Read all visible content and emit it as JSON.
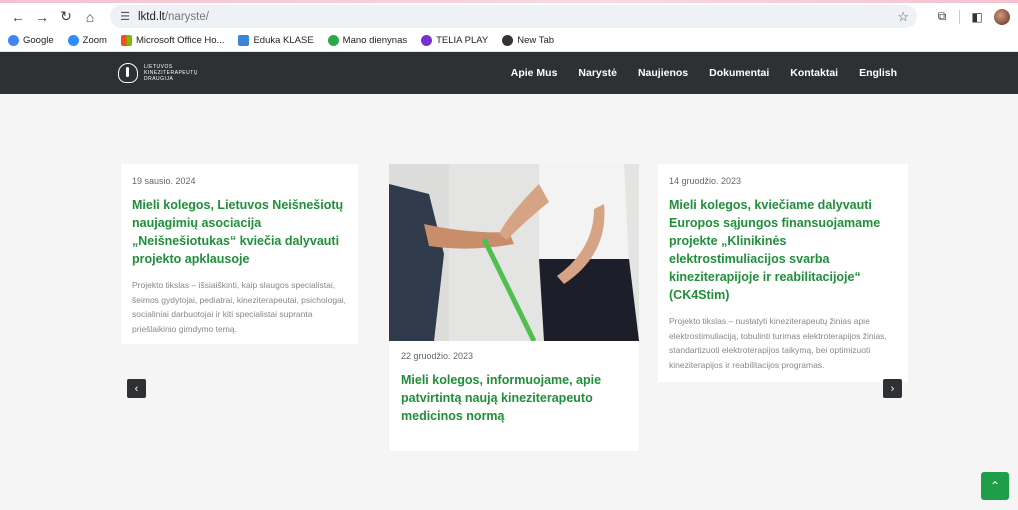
{
  "browser": {
    "url_host": "lktd.lt",
    "url_path": "/naryste/"
  },
  "bookmarks": [
    {
      "label": "Google",
      "color": "#4285f4"
    },
    {
      "label": "Zoom",
      "color": "#2d8cff"
    },
    {
      "label": "Microsoft Office Ho...",
      "color": "#f25022"
    },
    {
      "label": "Eduka KLASE",
      "color": "#3a86d6"
    },
    {
      "label": "Mano dienynas",
      "color": "#2aa84a"
    },
    {
      "label": "TELIA PLAY",
      "color": "#7b2fd1"
    },
    {
      "label": "New Tab",
      "color": "#333333"
    }
  ],
  "site": {
    "logo_text_line1": "Lietuvos",
    "logo_text_line2": "kineziterapeutų",
    "logo_text_line3": "draugija",
    "menu": [
      "Apie Mus",
      "Narystė",
      "Naujienos",
      "Dokumentai",
      "Kontaktai",
      "English"
    ]
  },
  "cards": [
    {
      "date": "19 sausio. 2024",
      "title": "Mieli kolegos, Lietuvos Neišnešiotų naujagimių asociacija „Neišnešiotukas“ kviečia dalyvauti projekto apklausoje",
      "excerpt": "Projekto tikslas – išsiaiškinti, kaip slaugos specialistai, šeimos gydytojai, pediatrai, kineziterapeutai, psichologai, socialiniai darbuotojai ir kiti specialistai supranta priešlaikinio gimdymo temą."
    },
    {
      "date": "22 gruodžio. 2023",
      "title": "Mieli kolegos, informuojame, apie patvirtintą naują kineziterapeuto medicinos normą",
      "excerpt": ""
    },
    {
      "date": "14 gruodžio. 2023",
      "title": "Mieli kolegos, kviečiame dalyvauti Europos sąjungos finansuojamame projekte „Klinikinės elektrostimuliacijos svarba kineziterapijoje ir reabilitacijoje“ (CK4Stim)",
      "excerpt": "Projekto tikslas – nustatyti kineziterapeutų žinias apie elektrostimuliaciją, tobulinti turimas elektroterapijos žinias, standartizuoti elektroterapijos taikymą, bei optimizuoti kineziterapijos ir reabilitacijos programas."
    }
  ],
  "colors": {
    "accent": "#1f8f3a",
    "nav_bg": "#2d3134"
  }
}
